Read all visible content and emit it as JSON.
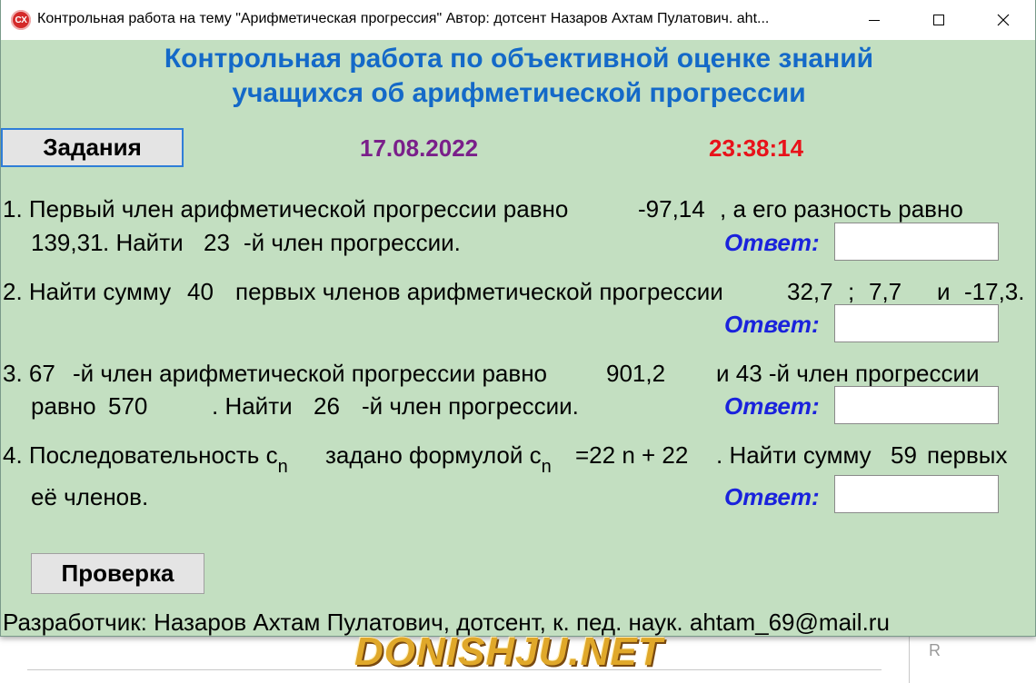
{
  "window": {
    "title": "Контрольная работа на тему \"Арифметическая прогрессия\" Автор: дотсент Назаров Ахтам Пулатович. aht...",
    "icon_text": "CX",
    "controls": [
      "minimize",
      "maximize",
      "close"
    ]
  },
  "header": {
    "line1": "Контрольная работа по объективной оценке знаний",
    "line2": "учащихся об арифметической прогрессии"
  },
  "toolbar": {
    "tasks_label": "Задания",
    "date": "17.08.2022",
    "time": "23:38:14"
  },
  "answer_label": "Ответ:",
  "tasks": {
    "t1": {
      "line1_a": "1. Первый член арифметической прогрессии равно",
      "a1": "-97,14",
      "line1_b": ", а его разность равно",
      "d": "139,31",
      "line2_a": ". Найти",
      "n": "23",
      "line2_b": "-й член прогрессии.",
      "answer_value": ""
    },
    "t2": {
      "line1_a": "2. Найти сумму",
      "n": "40",
      "line1_b": "первых членов арифметической прогрессии",
      "v1": "32,7",
      "sep1": ";",
      "v2": "7,7",
      "sep2": "и",
      "v3": "-17,3.",
      "answer_value": ""
    },
    "t3": {
      "k1": "3. 67",
      "text_a": "-й член арифметической прогрессии равно",
      "val1": "901,2",
      "text_b": "и 43 -й член прогрессии",
      "text_c": "равно",
      "val2": "570",
      "text_d": ". Найти",
      "n": "26",
      "text_e": "-й член прогрессии.",
      "answer_value": ""
    },
    "t4": {
      "text_a": "4. Последовательность с",
      "sub1": "n",
      "text_b": "задано формулой с",
      "sub2": "n",
      "formula": "=22 n + 22",
      "text_c": ". Найти сумму",
      "count": "59",
      "text_d": "первых",
      "text_e": "её членов.",
      "answer_value": ""
    }
  },
  "check_label": "Проверка",
  "footer": "Разработчик: Назаров Ахтам Пулатович, дотсент, к. пед. наук. ahtam_69@mail.ru",
  "watermark": "DONISHJU.NET",
  "background_letter": "R",
  "colors": {
    "window_bg": "#c3dfc1",
    "heading": "#1469c8",
    "date": "#7a1f8a",
    "time": "#e8121a",
    "answer_label": "#1a22dc"
  }
}
